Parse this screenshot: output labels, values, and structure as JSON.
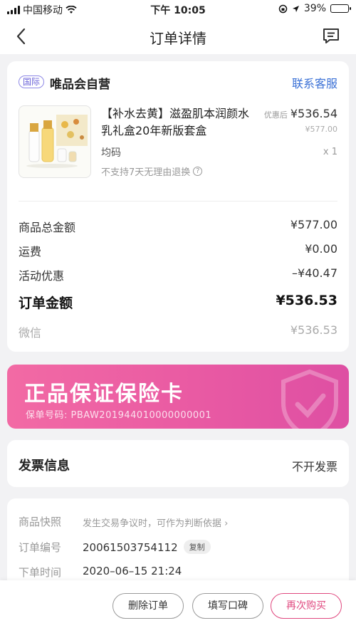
{
  "status_bar": {
    "carrier": "中国移动",
    "time": "下午 10:05",
    "battery": "39%",
    "battery_level": 0.39
  },
  "nav": {
    "title": "订单详情",
    "back_icon": "back-arrow-icon",
    "message_icon": "message-icon"
  },
  "store": {
    "badge": "国际",
    "name": "唯品会自营",
    "contact": "联系客服"
  },
  "product": {
    "name": "【补水去黄】滋盈肌本润颜水乳礼盒20年新版套盒",
    "price_tag": "优惠后",
    "price": "¥536.54",
    "original_price": "¥577.00",
    "spec": "均码",
    "quantity": "x 1",
    "refund_note": "不支持7天无理由退换",
    "refund_help": "?"
  },
  "summary": {
    "goods_total_label": "商品总金额",
    "goods_total": "¥577.00",
    "shipping_label": "运费",
    "shipping": "¥0.00",
    "discount_label": "活动优惠",
    "discount": "–¥40.47",
    "order_total_label": "订单金额",
    "order_total": "¥536.53",
    "payment_method": "微信",
    "payment_amount": "¥536.53"
  },
  "insurance": {
    "title": "正品保证保险卡",
    "policy_no": "保单号码: PBAW201944010000000001"
  },
  "invoice": {
    "label": "发票信息",
    "value": "不开发票"
  },
  "order_info": {
    "snapshot_label": "商品快照",
    "snapshot_value": "发生交易争议时，可作为判断依据 ›",
    "order_no_label": "订单编号",
    "order_no": "20061503754112",
    "copy_label": "复制",
    "time_label": "下单时间",
    "time": "2020–06–15  21:24"
  },
  "actions": {
    "delete": "删除订单",
    "review": "填写口碑",
    "rebuy": "再次购买"
  }
}
